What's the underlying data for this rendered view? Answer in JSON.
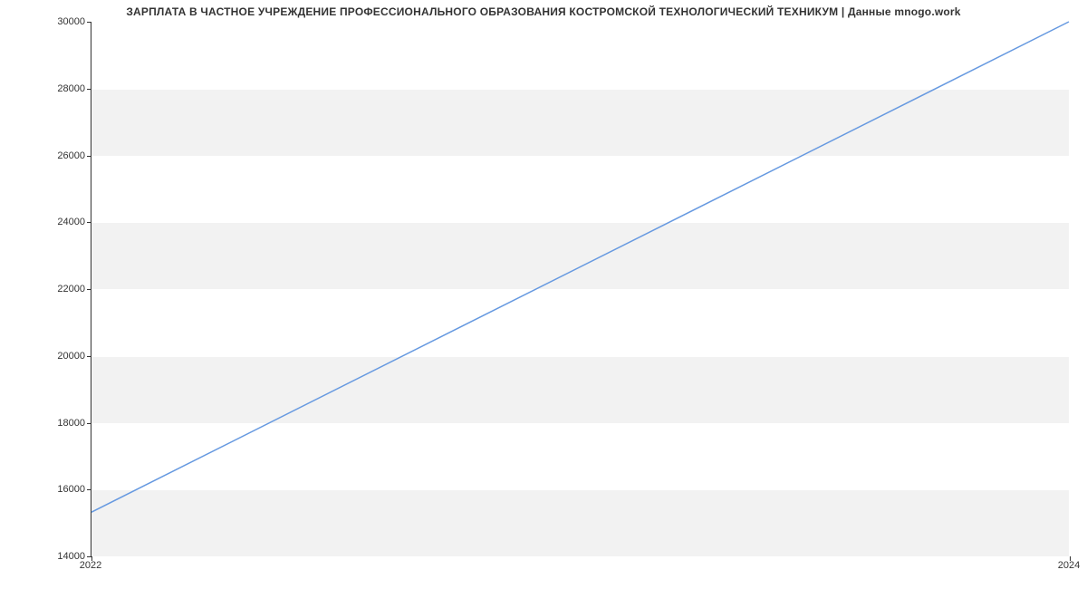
{
  "chart_data": {
    "type": "line",
    "title": "ЗАРПЛАТА В ЧАСТНОЕ УЧРЕЖДЕНИЕ ПРОФЕССИОНАЛЬНОГО ОБРАЗОВАНИЯ КОСТРОМСКОЙ ТЕХНОЛОГИЧЕСКИЙ ТЕХНИКУМ | Данные mnogo.work",
    "x": [
      2022,
      2024
    ],
    "values": [
      15300,
      30000
    ],
    "xlabel": "",
    "ylabel": "",
    "xlim": [
      2022,
      2024
    ],
    "ylim": [
      14000,
      30000
    ],
    "yticks": [
      14000,
      16000,
      18000,
      20000,
      22000,
      24000,
      26000,
      28000,
      30000
    ],
    "xticks": [
      2022,
      2024
    ],
    "line_color": "#6699e0",
    "band_color": "#f2f2f2"
  }
}
